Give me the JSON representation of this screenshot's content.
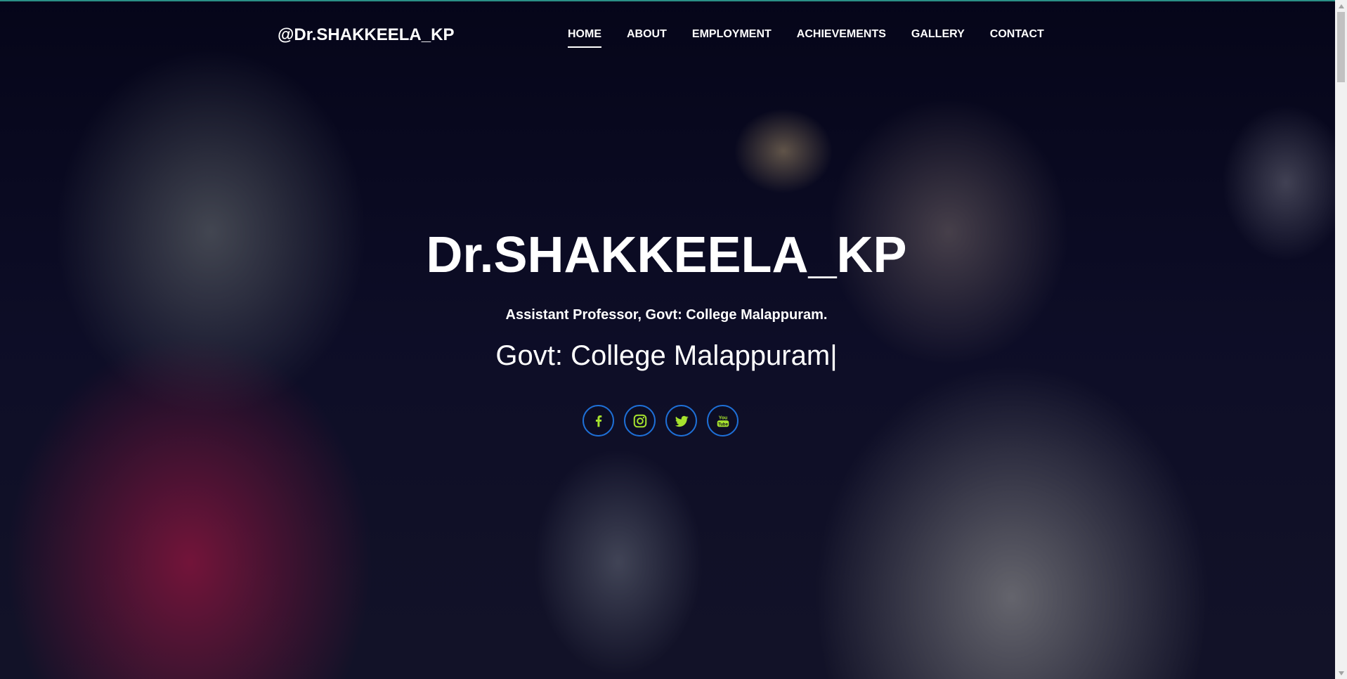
{
  "header": {
    "brand": "@Dr.SHAKKEELA_KP",
    "nav": [
      {
        "label": "HOME",
        "active": true
      },
      {
        "label": "ABOUT",
        "active": false
      },
      {
        "label": "EMPLOYMENT",
        "active": false
      },
      {
        "label": "ACHIEVEMENTS",
        "active": false
      },
      {
        "label": "GALLERY",
        "active": false
      },
      {
        "label": "CONTACT",
        "active": false
      }
    ]
  },
  "hero": {
    "title": "Dr.SHAKKEELA_KP",
    "subtitle": "Assistant Professor, Govt: College Malappuram.",
    "typed_text": "Govt: College Malappuram",
    "typed_cursor": "|",
    "social": [
      {
        "icon": "facebook-icon"
      },
      {
        "icon": "instagram-icon"
      },
      {
        "icon": "twitter-icon"
      },
      {
        "icon": "youtube-icon"
      }
    ]
  },
  "colors": {
    "social_border": "#1e6fd6",
    "social_icon": "#a6e22e",
    "text": "#ffffff"
  }
}
